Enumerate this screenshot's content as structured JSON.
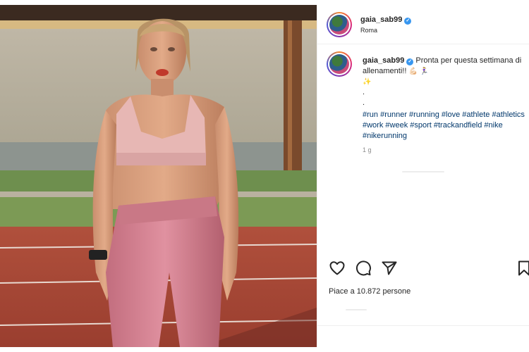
{
  "post": {
    "author": {
      "username": "gaia_sab99",
      "verified": true,
      "verified_badge": "✓",
      "location": "Roma"
    },
    "caption": {
      "username": "gaia_sab99",
      "text": "Pronta per questa settimana di allenamenti!!",
      "emojis": [
        "💪🏻",
        "🏃🏼‍♀️",
        "✨"
      ],
      "dot_lines": [
        ".",
        "."
      ],
      "hashtags": "#run #runner #running #love #athlete #athletics #work #week #sport #trackandfield #nike #nikerunning",
      "time_ago": "1 g"
    },
    "actions": {
      "icons": [
        "heart-icon",
        "comment-icon",
        "share-icon",
        "bookmark-icon"
      ]
    },
    "likes_label": "Piace a 10.872 persone"
  },
  "colors": {
    "verified": "#3897f0",
    "hashtag": "#00376b",
    "muted": "#8e8e8e",
    "track": "#b8503e",
    "outfit": "#d98a98"
  }
}
